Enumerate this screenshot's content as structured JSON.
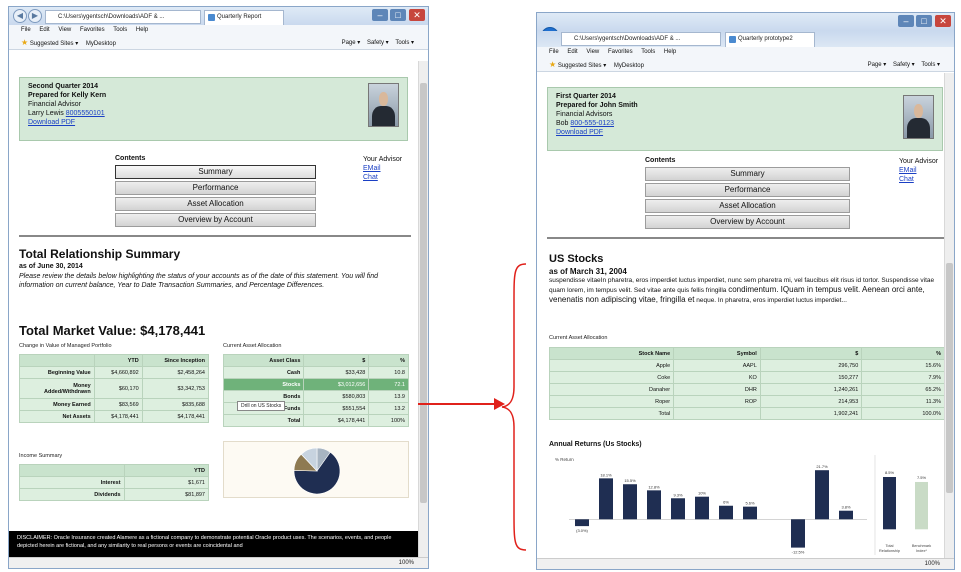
{
  "left": {
    "address": "C:\\Users\\ygentsch\\Downloads\\ADF & ...",
    "tab_title": "Quarterly Report",
    "menu": [
      "File",
      "Edit",
      "View",
      "Favorites",
      "Tools",
      "Help"
    ],
    "favorites": [
      "Suggested Sites ▾",
      "MyDesktop"
    ],
    "commands": [
      "Page ▾",
      "Safety ▾",
      "Tools ▾"
    ],
    "header": {
      "quarter": "Second Quarter 2014",
      "prepared_for": "Prepared for Kelly Kern",
      "role": "Financial Advisor",
      "advisor_name": "Larry Lewis",
      "phone": "8005550101",
      "download": "Download PDF"
    },
    "contents_label": "Contents",
    "nav": [
      "Summary",
      "Performance",
      "Asset Allocation",
      "Overview by Account"
    ],
    "your_advisor": {
      "label": "Your Advisor",
      "email": "EMail",
      "chat": "Chat"
    },
    "summary_title": "Total Relationship Summary",
    "as_of": "as of June 30, 2014",
    "intro": "Please review the details below highlighting the status of your accounts as of the date of this statement. You will find information on current balance, Year to Date Transaction Summaries, and Percentage Differences.",
    "market_value": "Total Market Value: $4,178,441",
    "change_label": "Change in Value of Managed Portfolio",
    "alloc_label": "Current Asset Allocation",
    "change_table": {
      "headers": [
        "",
        "YTD",
        "Since Inception"
      ],
      "rows": [
        [
          "Beginning Value",
          "$4,660,892",
          "$2,458,264"
        ],
        [
          "Money",
          "$60,170",
          "$3,342,753"
        ],
        [
          "Money Earned",
          "$83,569",
          "$835,688"
        ],
        [
          "Net Assets",
          "$4,178,441",
          "$4,178,441"
        ]
      ],
      "money_sub": "Added/Withdrawn"
    },
    "alloc_table": {
      "headers": [
        "Asset Class",
        "$",
        "%"
      ],
      "rows": [
        [
          "Cash",
          "$33,428",
          "10.8"
        ],
        [
          "Stocks",
          "$3,012,656",
          "72.1"
        ],
        [
          "Bonds",
          "$580,803",
          "13.9"
        ],
        [
          "Mutual Funds",
          "$551,554",
          "13.2"
        ],
        [
          "Total",
          "$4,178,441",
          "100%"
        ]
      ],
      "tooltip": "Drill on US Stocks"
    },
    "income_label": "Income Summary",
    "income_table": {
      "headers": [
        "",
        "YTD"
      ],
      "rows": [
        [
          "Interest",
          "$1,671"
        ],
        [
          "Dividends",
          "$81,897"
        ]
      ]
    },
    "disclaimer": "DISCLAIMER: Oracle Insurance created Alamere as a fictional company to demonstrate potential Oracle product uses. The scenarios, events, and people depicted herein are fictional, and any similarity to real persons or events are coincidental and",
    "zoom": "100%"
  },
  "right": {
    "address": "C:\\Users\\ygentsch\\Downloads\\ADF & ...",
    "tab_title": "Quarterly prototype2",
    "menu": [
      "File",
      "Edit",
      "View",
      "Favorites",
      "Tools",
      "Help"
    ],
    "favorites": [
      "Suggested Sites ▾",
      "MyDesktop"
    ],
    "commands": [
      "Page ▾",
      "Safety ▾",
      "Tools ▾"
    ],
    "header": {
      "quarter": "First Quarter 2014",
      "prepared_for": "Prepared for John Smith",
      "role": "Financial Advisors",
      "advisor_name": "Bob",
      "phone": "800-555-0123",
      "download": "Download PDF"
    },
    "contents_label": "Contents",
    "nav": [
      "Summary",
      "Performance",
      "Asset Allocation",
      "Overview by Account"
    ],
    "your_advisor": {
      "label": "Your Advisor",
      "email": "EMail",
      "chat": "Chat"
    },
    "section_title": "US Stocks",
    "as_of": "as of March 31, 2004",
    "lorem": "suspendisse vitaeIn pharetra, eros imperdiet luctus imperdiet, nunc sem pharetra mi, vel faucibus elit risus id tortor. Suspendisse vitae quam lorem, im tempus velit. Sed vitae ante quis fellis fringilla",
    "lorem_big": "condimentum. IQuam in tempus velit. Aenean orci ante, venenatis non adipiscing vitae, fringilla et",
    "lorem_end": "neque. In pharetra, eros imperdiet luctus imperdiet...",
    "alloc_label": "Current Asset Allocation",
    "stock_table": {
      "headers": [
        "Stock Name",
        "Symbol",
        "$",
        "%"
      ],
      "rows": [
        [
          "Apple",
          "AAPL",
          "296,750",
          "15.6%"
        ],
        [
          "Coke",
          "KO",
          "150,277",
          "7.9%"
        ],
        [
          "Danaher",
          "DHR",
          "1,240,261",
          "65.2%"
        ],
        [
          "Roper",
          "ROP",
          "214,953",
          "11.3%"
        ],
        [
          "Total",
          "",
          "1,902,241",
          "100.0%"
        ]
      ]
    },
    "zoom": "100%"
  },
  "chart_data": [
    {
      "type": "pie",
      "slices": [
        {
          "value": 10.8,
          "color": "#a8b5c2"
        },
        {
          "value": 72.1,
          "color": "#1f2e52"
        },
        {
          "value": 13.9,
          "color": "#8e7a52"
        },
        {
          "value": 13.2,
          "color": "#c7d3df"
        }
      ]
    },
    {
      "type": "bar",
      "title": "Annual Returns (Us Stocks)",
      "ylabel": "% Return",
      "values": [
        -3.0,
        18.1,
        15.5,
        12.8,
        9.3,
        10,
        6,
        5.6,
        0,
        -12.5,
        21.7,
        3.8
      ],
      "labels": [
        "(3.0%)",
        "18.1%",
        "15.5%",
        "12.8%",
        "9.3%",
        "10%",
        "6%",
        "5.6%",
        "",
        "-12.5%",
        "21.7%",
        "3.8%"
      ],
      "ylim": [
        -14,
        24
      ],
      "comparison": {
        "categories": [
          "Total Relationship",
          "Benchmark Index*"
        ],
        "values": [
          8.5,
          7.5
        ],
        "labels": [
          "8.5%",
          "7.5%"
        ],
        "colors": [
          "#1f2e52",
          "#c9dbc6"
        ]
      }
    }
  ],
  "colors": {
    "header_green": "#d5e9d8",
    "highlight": "#6fb27a",
    "arrow": "#e0211b"
  }
}
